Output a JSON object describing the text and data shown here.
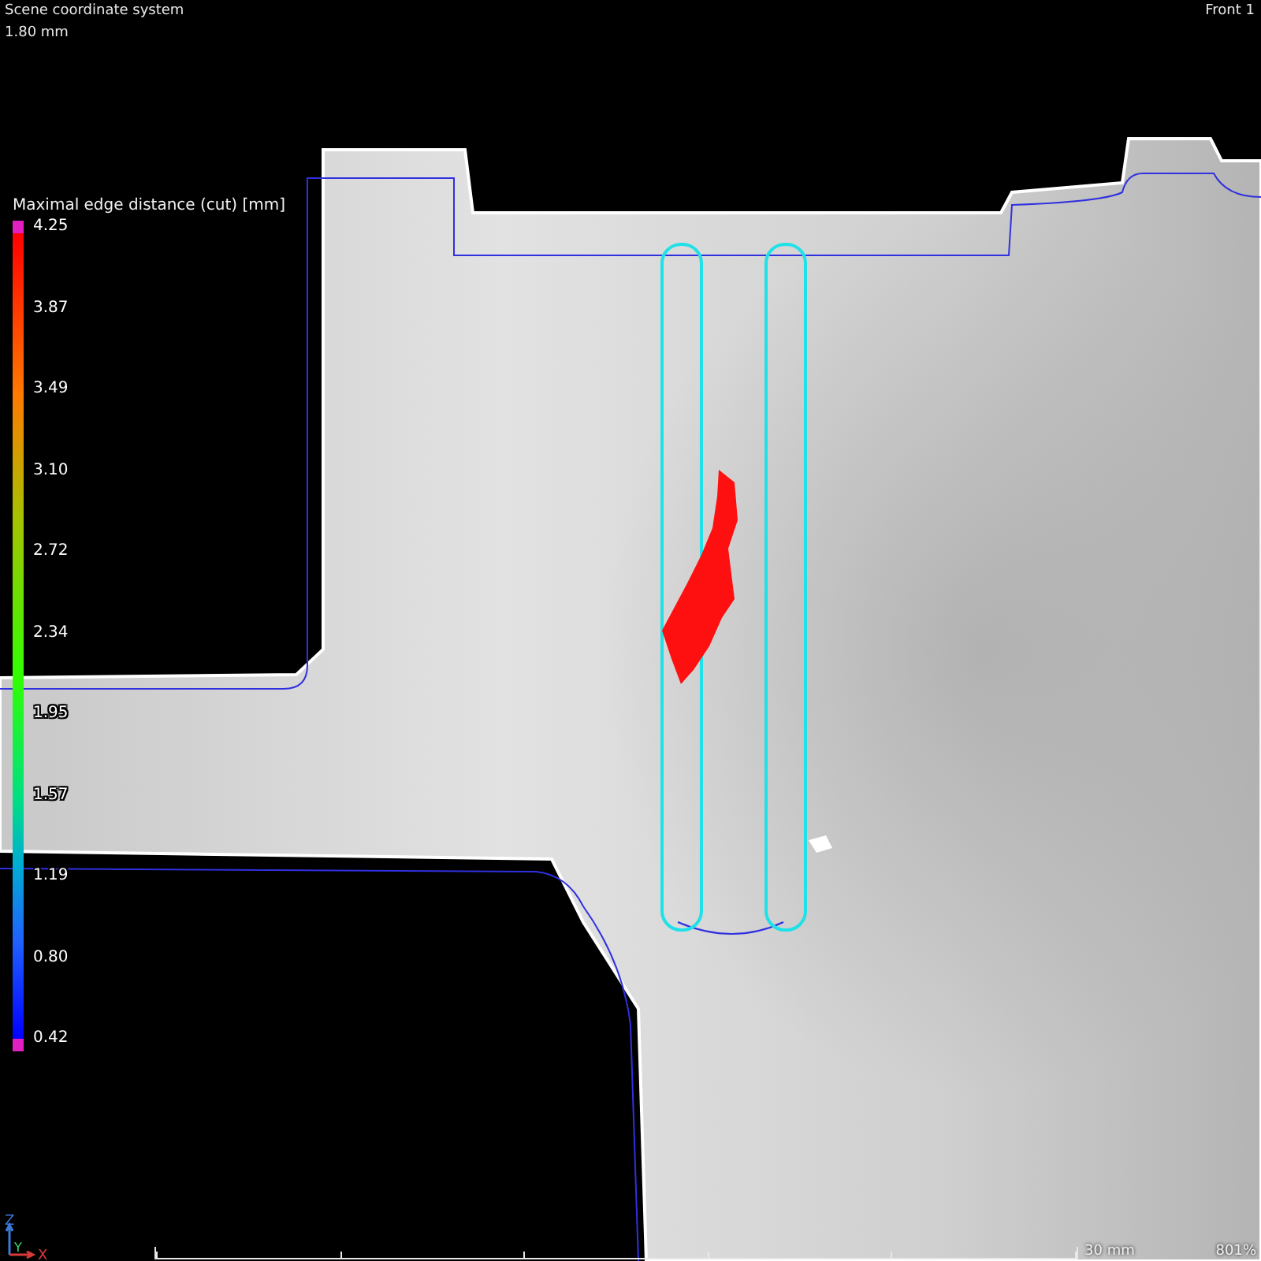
{
  "header": {
    "title": "Scene coordinate system",
    "subtitle": "1.80 mm",
    "view": "Front 1"
  },
  "legend": {
    "title": "Maximal edge distance (cut) [mm]",
    "labels": [
      "4.25",
      "3.87",
      "3.49",
      "3.10",
      "2.72",
      "2.34",
      "1.95",
      "1.57",
      "1.19",
      "0.80",
      "0.42"
    ]
  },
  "axes": {
    "z": "Z",
    "y": "Y",
    "x": "X"
  },
  "scale_bar": {
    "label": "30 mm"
  },
  "zoom": "801%"
}
